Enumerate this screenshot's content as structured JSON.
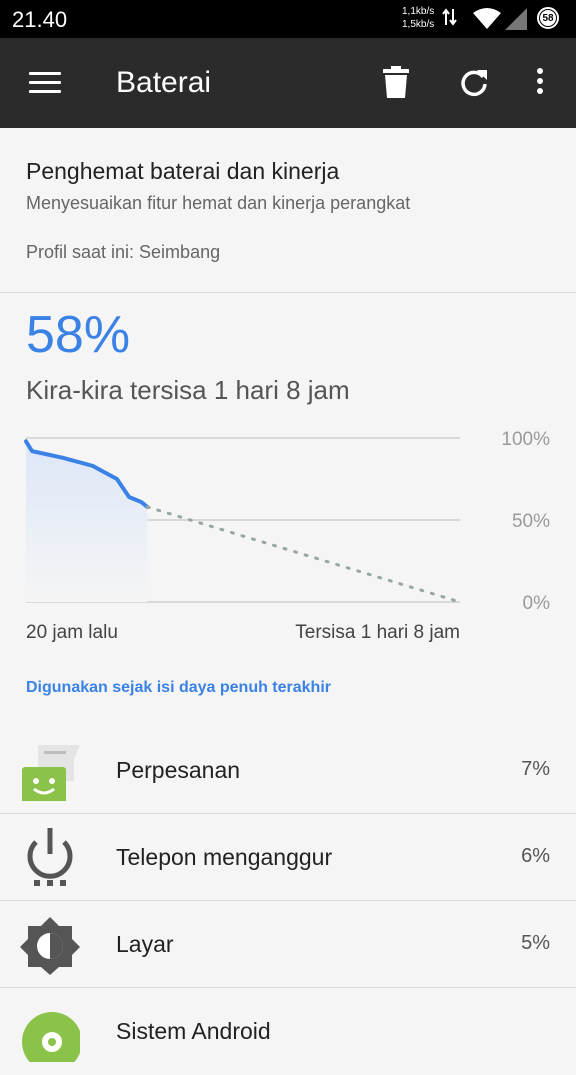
{
  "status": {
    "time": "21.40",
    "speed_up": "1,1kb/s",
    "speed_down": "1,5kb/s",
    "battery": "58"
  },
  "appbar": {
    "title": "Baterai",
    "icons": [
      "menu-icon",
      "trash-icon",
      "refresh-icon",
      "more-icon"
    ]
  },
  "saver": {
    "title": "Penghemat baterai dan kinerja",
    "subtitle": "Menyesuaikan fitur hemat dan kinerja perangkat",
    "profile": "Profil saat ini: Seimbang"
  },
  "battery": {
    "percent": "58%",
    "remaining": "Kira-kira tersisa 1 hari 8 jam"
  },
  "chart_data": {
    "type": "line",
    "ylabels": [
      "100%",
      "50%",
      "0%"
    ],
    "ylim": [
      0,
      100
    ],
    "x_start_label": "20 jam lalu",
    "x_end_label": "Tersisa 1 hari 8 jam",
    "actual": [
      [
        0,
        98
      ],
      [
        0.05,
        92
      ],
      [
        0.3,
        88
      ],
      [
        0.55,
        83
      ],
      [
        0.75,
        75
      ],
      [
        0.85,
        64
      ],
      [
        0.95,
        61
      ],
      [
        1,
        58
      ]
    ],
    "projection": [
      [
        1,
        58
      ],
      [
        3.58,
        0
      ]
    ],
    "colors": {
      "line": "#3b82e6",
      "fill": "#dde7f8",
      "projection": "#9aa6a0",
      "grid": "#cfcfcf"
    }
  },
  "usage": {
    "header": "Digunakan sejak isi daya penuh terakhir",
    "items": [
      {
        "name": "Perpesanan",
        "percent": "7%",
        "icon": "messaging-icon"
      },
      {
        "name": "Telepon menganggur",
        "percent": "6%",
        "icon": "power-icon"
      },
      {
        "name": "Layar",
        "percent": "5%",
        "icon": "brightness-icon"
      },
      {
        "name": "Sistem Android",
        "percent": "",
        "icon": "android-settings-icon"
      }
    ]
  }
}
